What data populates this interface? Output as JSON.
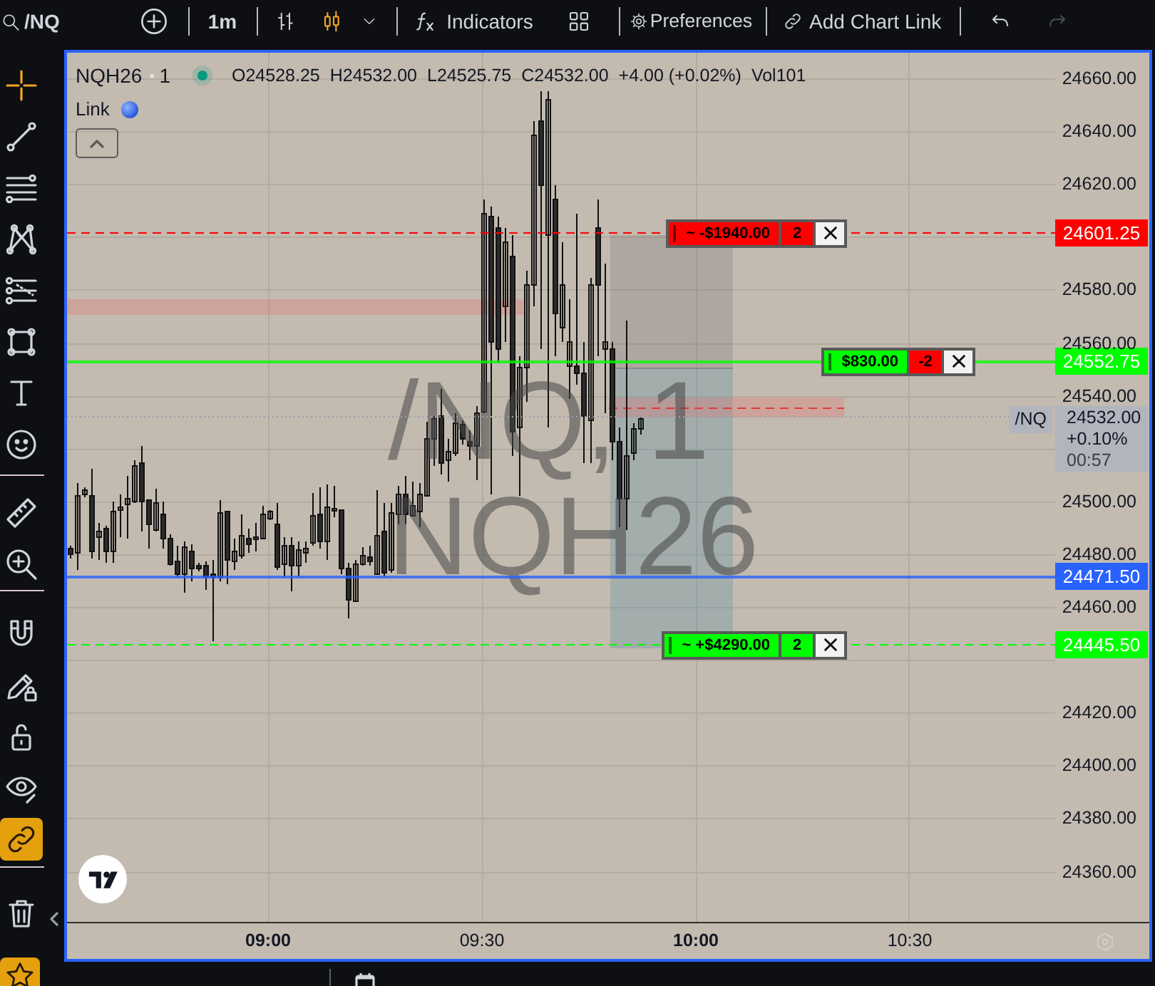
{
  "top_toolbar": {
    "symbol": "/NQ",
    "interval": "1m",
    "chart_types": [
      {
        "selected": false
      },
      {
        "selected": true
      }
    ],
    "indicators": "Indicators",
    "preferences": "Preferences",
    "chart_link": "Add Chart Link",
    "undo": {
      "disabled": false
    },
    "redo": {
      "disabled": true
    }
  },
  "left_toolbar": {
    "drawing_tools": [
      {
        "selected": true
      },
      {
        "selected": false
      },
      {
        "selected": false
      },
      {
        "selected": false
      },
      {
        "selected": false
      },
      {
        "selected": false
      },
      {
        "selected": false
      },
      {
        "selected": false
      }
    ],
    "measure_tools": [
      {
        "selected": false
      },
      {
        "selected": false
      }
    ],
    "toggles": [
      {
        "on": false
      },
      {
        "on": false
      },
      {
        "on": false
      },
      {
        "on": false
      },
      {
        "on": true
      }
    ],
    "favorites": {
      "on": true
    }
  },
  "legend": {
    "symbol": "NQH26",
    "interval": "1",
    "values": [
      "O24528.25",
      "H24532.00",
      "L24525.75",
      "C24532.00",
      "+4.00 (+0.02%)",
      "Vol101"
    ],
    "link": "Link"
  },
  "watermark": [
    "/NQ, 1",
    "NQH26"
  ],
  "price_axis": {
    "ticks": [
      "24660.00",
      "24640.00",
      "24620.00",
      "24580.00",
      "24560.00",
      "24540.00",
      "24500.00",
      "24480.00",
      "24460.00",
      "24420.00",
      "24400.00",
      "24380.00",
      "24360.00"
    ]
  },
  "price_lines": [
    {
      "kind": "order",
      "color": "#ff0000",
      "price": "24601.25",
      "order": {
        "pnl": {
          "text": "~ -$1940.00",
          "color": "#ff0000"
        },
        "quantity": {
          "text": "2",
          "color": "#ff0000"
        }
      }
    },
    {
      "kind": "position",
      "color": "#00ff00",
      "price": "24552.75",
      "order": {
        "pnl": {
          "text": "$830.00",
          "color": "#00ff00"
        },
        "quantity": {
          "text": "-2",
          "color": "#ff0000"
        }
      }
    },
    {
      "kind": "level",
      "color": "#2962ff",
      "price": "24471.50"
    },
    {
      "kind": "order",
      "color": "#00ff00",
      "price": "24445.50",
      "order": {
        "pnl": {
          "text": "~ +$4290.00",
          "color": "#00ff00"
        },
        "quantity": {
          "text": "2",
          "color": "#00ff00"
        }
      }
    }
  ],
  "last_price": {
    "symbol": "/NQ",
    "price": "24532.00",
    "change": "+0.10%",
    "countdown": "00:57"
  },
  "time_axis": [
    {
      "label": "09:00",
      "kind": "hour"
    },
    {
      "label": "09:30",
      "kind": "half-hour"
    },
    {
      "label": "10:00",
      "kind": "hour"
    },
    {
      "label": "10:30",
      "kind": "half-hour"
    }
  ]
}
